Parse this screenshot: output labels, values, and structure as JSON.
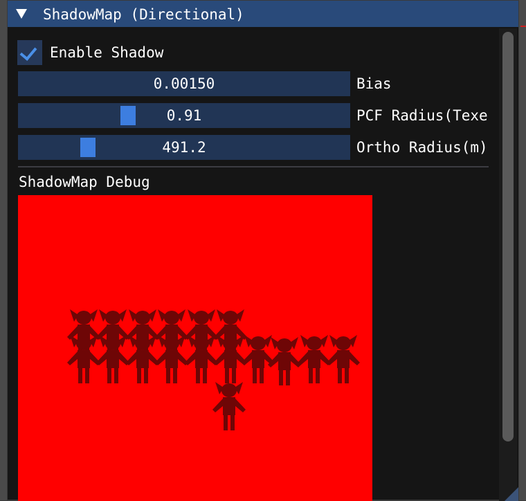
{
  "window": {
    "title": "ShadowMap (Directional)",
    "collapse_icon": "triangle-down-icon"
  },
  "enable_shadow": {
    "label": "Enable Shadow",
    "checked": true,
    "check_icon": "checkmark-icon"
  },
  "sliders": [
    {
      "value_text": "0.00150",
      "label": "Bias",
      "grab_fraction": null
    },
    {
      "value_text": "0.91",
      "label": "PCF Radius(Texe",
      "grab_fraction": 0.32
    },
    {
      "value_text": "491.2",
      "label": "Ortho Radius(m)",
      "grab_fraction": 0.19
    }
  ],
  "debug": {
    "heading": "ShadowMap Debug",
    "background_color": "#ff0000",
    "silhouette_color": "#6e0606"
  },
  "colors": {
    "title_bar": "#294a7a",
    "frame_bg": "#213555",
    "accent": "#3d7ee0"
  }
}
